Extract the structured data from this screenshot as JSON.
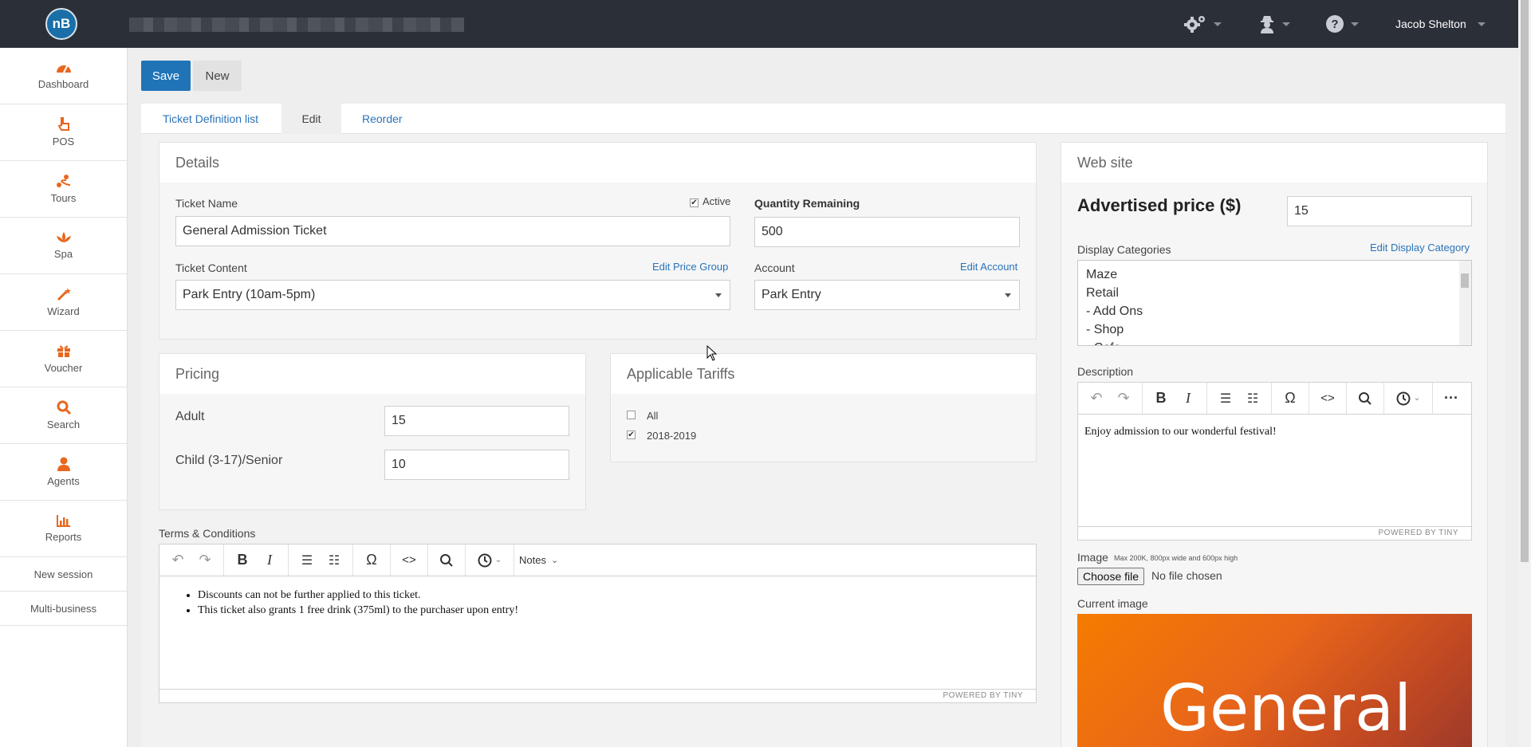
{
  "topbar": {
    "logo_text": "nB",
    "user_name": "Jacob Shelton",
    "icons": [
      "gears-icon",
      "agent-icon",
      "help-icon"
    ]
  },
  "sidebar": {
    "items": [
      {
        "label": "Dashboard",
        "icon": "speedometer-icon"
      },
      {
        "label": "POS",
        "icon": "hand-pointer-icon"
      },
      {
        "label": "Tours",
        "icon": "route-icon"
      },
      {
        "label": "Spa",
        "icon": "lotus-icon"
      },
      {
        "label": "Wizard",
        "icon": "magic-wand-icon"
      },
      {
        "label": "Voucher",
        "icon": "gift-icon"
      },
      {
        "label": "Search",
        "icon": "search-icon"
      },
      {
        "label": "Agents",
        "icon": "user-icon"
      },
      {
        "label": "Reports",
        "icon": "bar-chart-icon"
      }
    ],
    "links": [
      "New session",
      "Multi-business"
    ],
    "accent": "#e8671e"
  },
  "actions": {
    "save": "Save",
    "new": "New"
  },
  "tabs": [
    "Ticket Definition list",
    "Edit",
    "Reorder"
  ],
  "details": {
    "title": "Details",
    "ticket_name_label": "Ticket Name",
    "active_label": "Active",
    "active_checked": true,
    "ticket_name_value": "General Admission Ticket",
    "quantity_label": "Quantity Remaining",
    "quantity_value": "500",
    "content_label": "Ticket Content",
    "content_link": "Edit Price Group",
    "content_value": "Park Entry (10am-5pm)",
    "account_label": "Account",
    "account_link": "Edit Account",
    "account_value": "Park Entry"
  },
  "pricing": {
    "title": "Pricing",
    "rows": [
      {
        "label": "Adult",
        "value": "15"
      },
      {
        "label": "Child (3-17)/Senior",
        "value": "10"
      }
    ]
  },
  "tariffs": {
    "title": "Applicable Tariffs",
    "items": [
      {
        "label": "All",
        "checked": false
      },
      {
        "label": "2018-2019",
        "checked": true
      }
    ]
  },
  "terms": {
    "label": "Terms & Conditions",
    "notes_label": "Notes",
    "bullets": [
      "Discounts can not be further applied to this ticket.",
      "This ticket also grants 1 free drink (375ml) to the purchaser upon entry!"
    ],
    "powered": "POWERED BY TINY"
  },
  "website": {
    "title": "Web site",
    "price_label": "Advertised price ($)",
    "price_value": "15",
    "categories_label": "Display Categories",
    "categories_link": "Edit Display Category",
    "categories": [
      "Maze",
      "Retail",
      "- Add Ons",
      "- Shop",
      "- Cafe"
    ],
    "description_label": "Description",
    "description_text": "Enjoy admission to our wonderful festival!",
    "powered": "POWERED BY TINY",
    "image_label": "Image",
    "image_hint": "Max 200K, 800px wide and 600px high",
    "choose_file": "Choose file",
    "no_file": "No file chosen",
    "current_image_label": "Current image",
    "current_image_text": "General"
  }
}
